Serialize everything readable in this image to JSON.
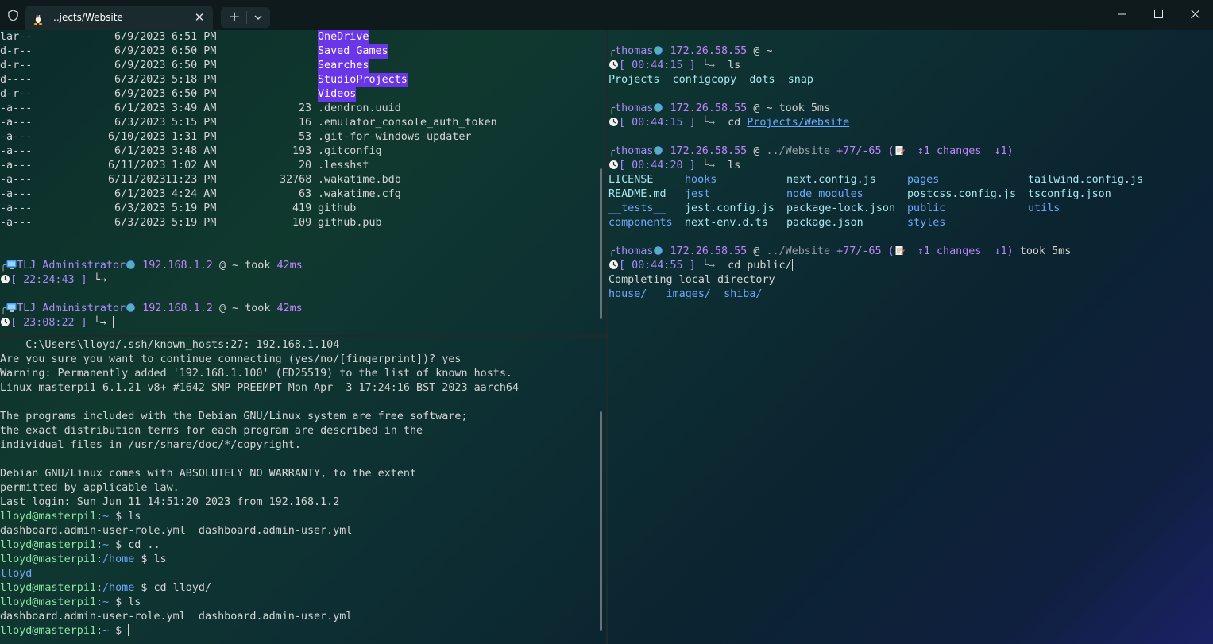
{
  "window": {
    "tab_title": "..jects/Website",
    "tab_close": "✕",
    "new_tab": "+"
  },
  "colors": {
    "directory_highlight": "#6b35e8",
    "prompt_user": "#a78bfa",
    "link": "#6ea8ff"
  },
  "pane_top_left": {
    "listing": [
      {
        "mode": "lar--",
        "date": "6/9/2023",
        "time": "6:51 PM",
        "size": "",
        "name": "OneDrive",
        "is_dir": true
      },
      {
        "mode": "d-r--",
        "date": "6/9/2023",
        "time": "6:50 PM",
        "size": "",
        "name": "Saved Games",
        "is_dir": true
      },
      {
        "mode": "d-r--",
        "date": "6/9/2023",
        "time": "6:50 PM",
        "size": "",
        "name": "Searches",
        "is_dir": true
      },
      {
        "mode": "d----",
        "date": "6/3/2023",
        "time": "5:18 PM",
        "size": "",
        "name": "StudioProjects",
        "is_dir": true
      },
      {
        "mode": "d-r--",
        "date": "6/9/2023",
        "time": "6:50 PM",
        "size": "",
        "name": "Videos",
        "is_dir": true
      },
      {
        "mode": "-a---",
        "date": "6/1/2023",
        "time": "3:49 AM",
        "size": "23",
        "name": ".dendron.uuid",
        "is_dir": false
      },
      {
        "mode": "-a---",
        "date": "6/3/2023",
        "time": "5:15 PM",
        "size": "16",
        "name": ".emulator_console_auth_token",
        "is_dir": false
      },
      {
        "mode": "-a---",
        "date": "6/10/2023",
        "time": "1:31 PM",
        "size": "53",
        "name": ".git-for-windows-updater",
        "is_dir": false
      },
      {
        "mode": "-a---",
        "date": "6/1/2023",
        "time": "3:48 AM",
        "size": "193",
        "name": ".gitconfig",
        "is_dir": false
      },
      {
        "mode": "-a---",
        "date": "6/11/2023",
        "time": "1:02 AM",
        "size": "20",
        "name": ".lesshst",
        "is_dir": false
      },
      {
        "mode": "-a---",
        "date": "6/11/2023",
        "time": "11:23 PM",
        "size": "32768",
        "name": ".wakatime.bdb",
        "is_dir": false
      },
      {
        "mode": "-a---",
        "date": "6/1/2023",
        "time": "4:24 AM",
        "size": "63",
        "name": ".wakatime.cfg",
        "is_dir": false
      },
      {
        "mode": "-a---",
        "date": "6/3/2023",
        "time": "5:19 PM",
        "size": "419",
        "name": "github",
        "is_dir": false
      },
      {
        "mode": "-a---",
        "date": "6/3/2023",
        "time": "5:19 PM",
        "size": "109",
        "name": "github.pub",
        "is_dir": false
      }
    ],
    "prompts": [
      {
        "user": "TLJ Administrator",
        "host": "192.168.1.2",
        "at": "@",
        "path": "~",
        "took": "took",
        "duration": "42ms",
        "clock": "[ 22:24:43 ]",
        "arrow": "└→"
      },
      {
        "user": "TLJ Administrator",
        "host": "192.168.1.2",
        "at": "@",
        "path": "~",
        "took": "took",
        "duration": "42ms",
        "clock": "[ 23:08:22 ]",
        "arrow": "└→"
      }
    ]
  },
  "pane_bottom_left": {
    "lines": [
      "    C:\\Users\\lloyd/.ssh/known_hosts:27: 192.168.1.104",
      "Are you sure you want to continue connecting (yes/no/[fingerprint])? yes",
      "Warning: Permanently added '192.168.1.100' (ED25519) to the list of known hosts.",
      "Linux masterpi1 6.1.21-v8+ #1642 SMP PREEMPT Mon Apr  3 17:24:16 BST 2023 aarch64",
      "",
      "The programs included with the Debian GNU/Linux system are free software;",
      "the exact distribution terms for each program are described in the",
      "individual files in /usr/share/doc/*/copyright.",
      "",
      "Debian GNU/Linux comes with ABSOLUTELY NO WARRANTY, to the extent",
      "permitted by applicable law.",
      "Last login: Sun Jun 11 14:51:20 2023 from 192.168.1.2"
    ],
    "session": [
      {
        "type": "prompt",
        "user": "lloyd@masterpi1",
        "path": "~",
        "cmd": "ls"
      },
      {
        "type": "output",
        "text": "dashboard.admin-user-role.yml  dashboard.admin-user.yml"
      },
      {
        "type": "prompt",
        "user": "lloyd@masterpi1",
        "path": "~",
        "cmd": "cd .."
      },
      {
        "type": "prompt",
        "user": "lloyd@masterpi1",
        "path": "/home",
        "cmd": "ls"
      },
      {
        "type": "output_dir",
        "text": "lloyd"
      },
      {
        "type": "prompt",
        "user": "lloyd@masterpi1",
        "path": "/home",
        "cmd": "cd lloyd/"
      },
      {
        "type": "prompt",
        "user": "lloyd@masterpi1",
        "path": "~",
        "cmd": "ls"
      },
      {
        "type": "output",
        "text": "dashboard.admin-user-role.yml  dashboard.admin-user.yml"
      },
      {
        "type": "prompt",
        "user": "lloyd@masterpi1",
        "path": "~",
        "cmd": ""
      }
    ]
  },
  "pane_right": {
    "blocks": [
      {
        "user": "thomas",
        "host": "172.26.58.55",
        "at": "@",
        "path": "~",
        "extra": "",
        "clock": "[ 00:44:15 ]",
        "arrow": "└→",
        "cmd": "ls"
      },
      {
        "user": "thomas",
        "host": "172.26.58.55",
        "at": "@",
        "path": "~",
        "extra": "took 5ms",
        "clock": "[ 00:44:15 ]",
        "arrow": "└→",
        "cmd": "cd",
        "cmd_arg": "Projects/Website"
      },
      {
        "user": "thomas",
        "host": "172.26.58.55",
        "at": "@",
        "path": "../Website",
        "git_plus": "+77",
        "git_minus": "/-65",
        "paren_open": "(",
        "git_changes": "↕1 changes",
        "git_behind": "↓1)",
        "extra": "",
        "clock": "[ 00:44:20 ]",
        "arrow": "└→",
        "cmd": "ls"
      },
      {
        "user": "thomas",
        "host": "172.26.58.55",
        "at": "@",
        "path": "../Website",
        "git_plus": "+77",
        "git_minus": "/-65",
        "paren_open": "(",
        "git_changes": "↕1 changes",
        "git_behind": "↓1)",
        "extra": "took 5ms",
        "clock": "[ 00:44:55 ]",
        "arrow": "└→",
        "cmd": "cd public/"
      }
    ],
    "ls_home": [
      "Projects",
      "configcopy",
      "dots",
      "snap"
    ],
    "ls_website": [
      [
        {
          "t": "LICENSE",
          "k": "f"
        },
        {
          "t": "hooks",
          "k": "d"
        },
        {
          "t": "next.config.js",
          "k": "f"
        },
        {
          "t": "pages",
          "k": "d"
        },
        {
          "t": "tailwind.config.js",
          "k": "f"
        }
      ],
      [
        {
          "t": "README.md",
          "k": "f"
        },
        {
          "t": "jest",
          "k": "d"
        },
        {
          "t": "node_modules",
          "k": "d"
        },
        {
          "t": "postcss.config.js",
          "k": "f"
        },
        {
          "t": "tsconfig.json",
          "k": "f"
        }
      ],
      [
        {
          "t": "__tests__",
          "k": "d"
        },
        {
          "t": "jest.config.js",
          "k": "f"
        },
        {
          "t": "package-lock.json",
          "k": "f"
        },
        {
          "t": "public",
          "k": "d"
        },
        {
          "t": "utils",
          "k": "d"
        }
      ],
      [
        {
          "t": "components",
          "k": "d"
        },
        {
          "t": "next-env.d.ts",
          "k": "f"
        },
        {
          "t": "package.json",
          "k": "f"
        },
        {
          "t": "styles",
          "k": "d"
        }
      ]
    ],
    "completing": "Completing local directory",
    "completion_items": [
      "house/",
      "images/",
      "shiba/"
    ]
  }
}
